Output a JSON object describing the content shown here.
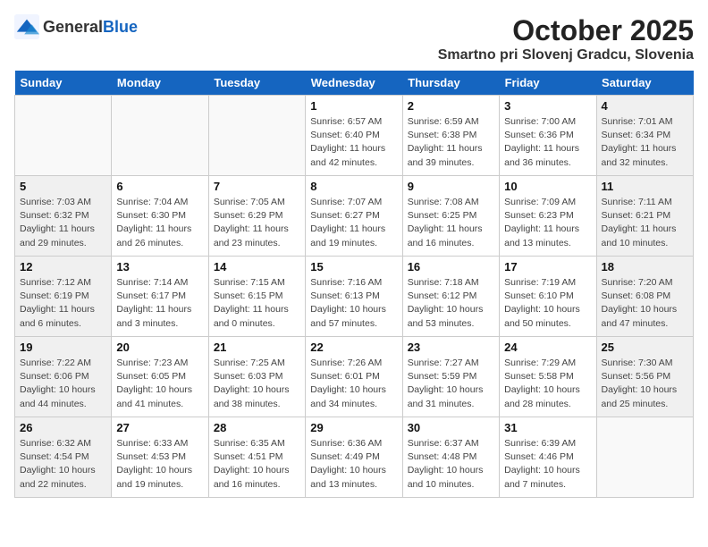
{
  "header": {
    "logo_general": "General",
    "logo_blue": "Blue",
    "month": "October 2025",
    "location": "Smartno pri Slovenj Gradcu, Slovenia"
  },
  "weekdays": [
    "Sunday",
    "Monday",
    "Tuesday",
    "Wednesday",
    "Thursday",
    "Friday",
    "Saturday"
  ],
  "weeks": [
    [
      {
        "day": "",
        "type": "empty",
        "detail": ""
      },
      {
        "day": "",
        "type": "empty",
        "detail": ""
      },
      {
        "day": "",
        "type": "empty",
        "detail": ""
      },
      {
        "day": "1",
        "type": "weekday",
        "detail": "Sunrise: 6:57 AM\nSunset: 6:40 PM\nDaylight: 11 hours\nand 42 minutes."
      },
      {
        "day": "2",
        "type": "weekday",
        "detail": "Sunrise: 6:59 AM\nSunset: 6:38 PM\nDaylight: 11 hours\nand 39 minutes."
      },
      {
        "day": "3",
        "type": "weekday",
        "detail": "Sunrise: 7:00 AM\nSunset: 6:36 PM\nDaylight: 11 hours\nand 36 minutes."
      },
      {
        "day": "4",
        "type": "weekend",
        "detail": "Sunrise: 7:01 AM\nSunset: 6:34 PM\nDaylight: 11 hours\nand 32 minutes."
      }
    ],
    [
      {
        "day": "5",
        "type": "weekend",
        "detail": "Sunrise: 7:03 AM\nSunset: 6:32 PM\nDaylight: 11 hours\nand 29 minutes."
      },
      {
        "day": "6",
        "type": "weekday",
        "detail": "Sunrise: 7:04 AM\nSunset: 6:30 PM\nDaylight: 11 hours\nand 26 minutes."
      },
      {
        "day": "7",
        "type": "weekday",
        "detail": "Sunrise: 7:05 AM\nSunset: 6:29 PM\nDaylight: 11 hours\nand 23 minutes."
      },
      {
        "day": "8",
        "type": "weekday",
        "detail": "Sunrise: 7:07 AM\nSunset: 6:27 PM\nDaylight: 11 hours\nand 19 minutes."
      },
      {
        "day": "9",
        "type": "weekday",
        "detail": "Sunrise: 7:08 AM\nSunset: 6:25 PM\nDaylight: 11 hours\nand 16 minutes."
      },
      {
        "day": "10",
        "type": "weekday",
        "detail": "Sunrise: 7:09 AM\nSunset: 6:23 PM\nDaylight: 11 hours\nand 13 minutes."
      },
      {
        "day": "11",
        "type": "weekend",
        "detail": "Sunrise: 7:11 AM\nSunset: 6:21 PM\nDaylight: 11 hours\nand 10 minutes."
      }
    ],
    [
      {
        "day": "12",
        "type": "weekend",
        "detail": "Sunrise: 7:12 AM\nSunset: 6:19 PM\nDaylight: 11 hours\nand 6 minutes."
      },
      {
        "day": "13",
        "type": "weekday",
        "detail": "Sunrise: 7:14 AM\nSunset: 6:17 PM\nDaylight: 11 hours\nand 3 minutes."
      },
      {
        "day": "14",
        "type": "weekday",
        "detail": "Sunrise: 7:15 AM\nSunset: 6:15 PM\nDaylight: 11 hours\nand 0 minutes."
      },
      {
        "day": "15",
        "type": "weekday",
        "detail": "Sunrise: 7:16 AM\nSunset: 6:13 PM\nDaylight: 10 hours\nand 57 minutes."
      },
      {
        "day": "16",
        "type": "weekday",
        "detail": "Sunrise: 7:18 AM\nSunset: 6:12 PM\nDaylight: 10 hours\nand 53 minutes."
      },
      {
        "day": "17",
        "type": "weekday",
        "detail": "Sunrise: 7:19 AM\nSunset: 6:10 PM\nDaylight: 10 hours\nand 50 minutes."
      },
      {
        "day": "18",
        "type": "weekend",
        "detail": "Sunrise: 7:20 AM\nSunset: 6:08 PM\nDaylight: 10 hours\nand 47 minutes."
      }
    ],
    [
      {
        "day": "19",
        "type": "weekend",
        "detail": "Sunrise: 7:22 AM\nSunset: 6:06 PM\nDaylight: 10 hours\nand 44 minutes."
      },
      {
        "day": "20",
        "type": "weekday",
        "detail": "Sunrise: 7:23 AM\nSunset: 6:05 PM\nDaylight: 10 hours\nand 41 minutes."
      },
      {
        "day": "21",
        "type": "weekday",
        "detail": "Sunrise: 7:25 AM\nSunset: 6:03 PM\nDaylight: 10 hours\nand 38 minutes."
      },
      {
        "day": "22",
        "type": "weekday",
        "detail": "Sunrise: 7:26 AM\nSunset: 6:01 PM\nDaylight: 10 hours\nand 34 minutes."
      },
      {
        "day": "23",
        "type": "weekday",
        "detail": "Sunrise: 7:27 AM\nSunset: 5:59 PM\nDaylight: 10 hours\nand 31 minutes."
      },
      {
        "day": "24",
        "type": "weekday",
        "detail": "Sunrise: 7:29 AM\nSunset: 5:58 PM\nDaylight: 10 hours\nand 28 minutes."
      },
      {
        "day": "25",
        "type": "weekend",
        "detail": "Sunrise: 7:30 AM\nSunset: 5:56 PM\nDaylight: 10 hours\nand 25 minutes."
      }
    ],
    [
      {
        "day": "26",
        "type": "weekend",
        "detail": "Sunrise: 6:32 AM\nSunset: 4:54 PM\nDaylight: 10 hours\nand 22 minutes."
      },
      {
        "day": "27",
        "type": "weekday",
        "detail": "Sunrise: 6:33 AM\nSunset: 4:53 PM\nDaylight: 10 hours\nand 19 minutes."
      },
      {
        "day": "28",
        "type": "weekday",
        "detail": "Sunrise: 6:35 AM\nSunset: 4:51 PM\nDaylight: 10 hours\nand 16 minutes."
      },
      {
        "day": "29",
        "type": "weekday",
        "detail": "Sunrise: 6:36 AM\nSunset: 4:49 PM\nDaylight: 10 hours\nand 13 minutes."
      },
      {
        "day": "30",
        "type": "weekday",
        "detail": "Sunrise: 6:37 AM\nSunset: 4:48 PM\nDaylight: 10 hours\nand 10 minutes."
      },
      {
        "day": "31",
        "type": "weekday",
        "detail": "Sunrise: 6:39 AM\nSunset: 4:46 PM\nDaylight: 10 hours\nand 7 minutes."
      },
      {
        "day": "",
        "type": "empty",
        "detail": ""
      }
    ]
  ]
}
